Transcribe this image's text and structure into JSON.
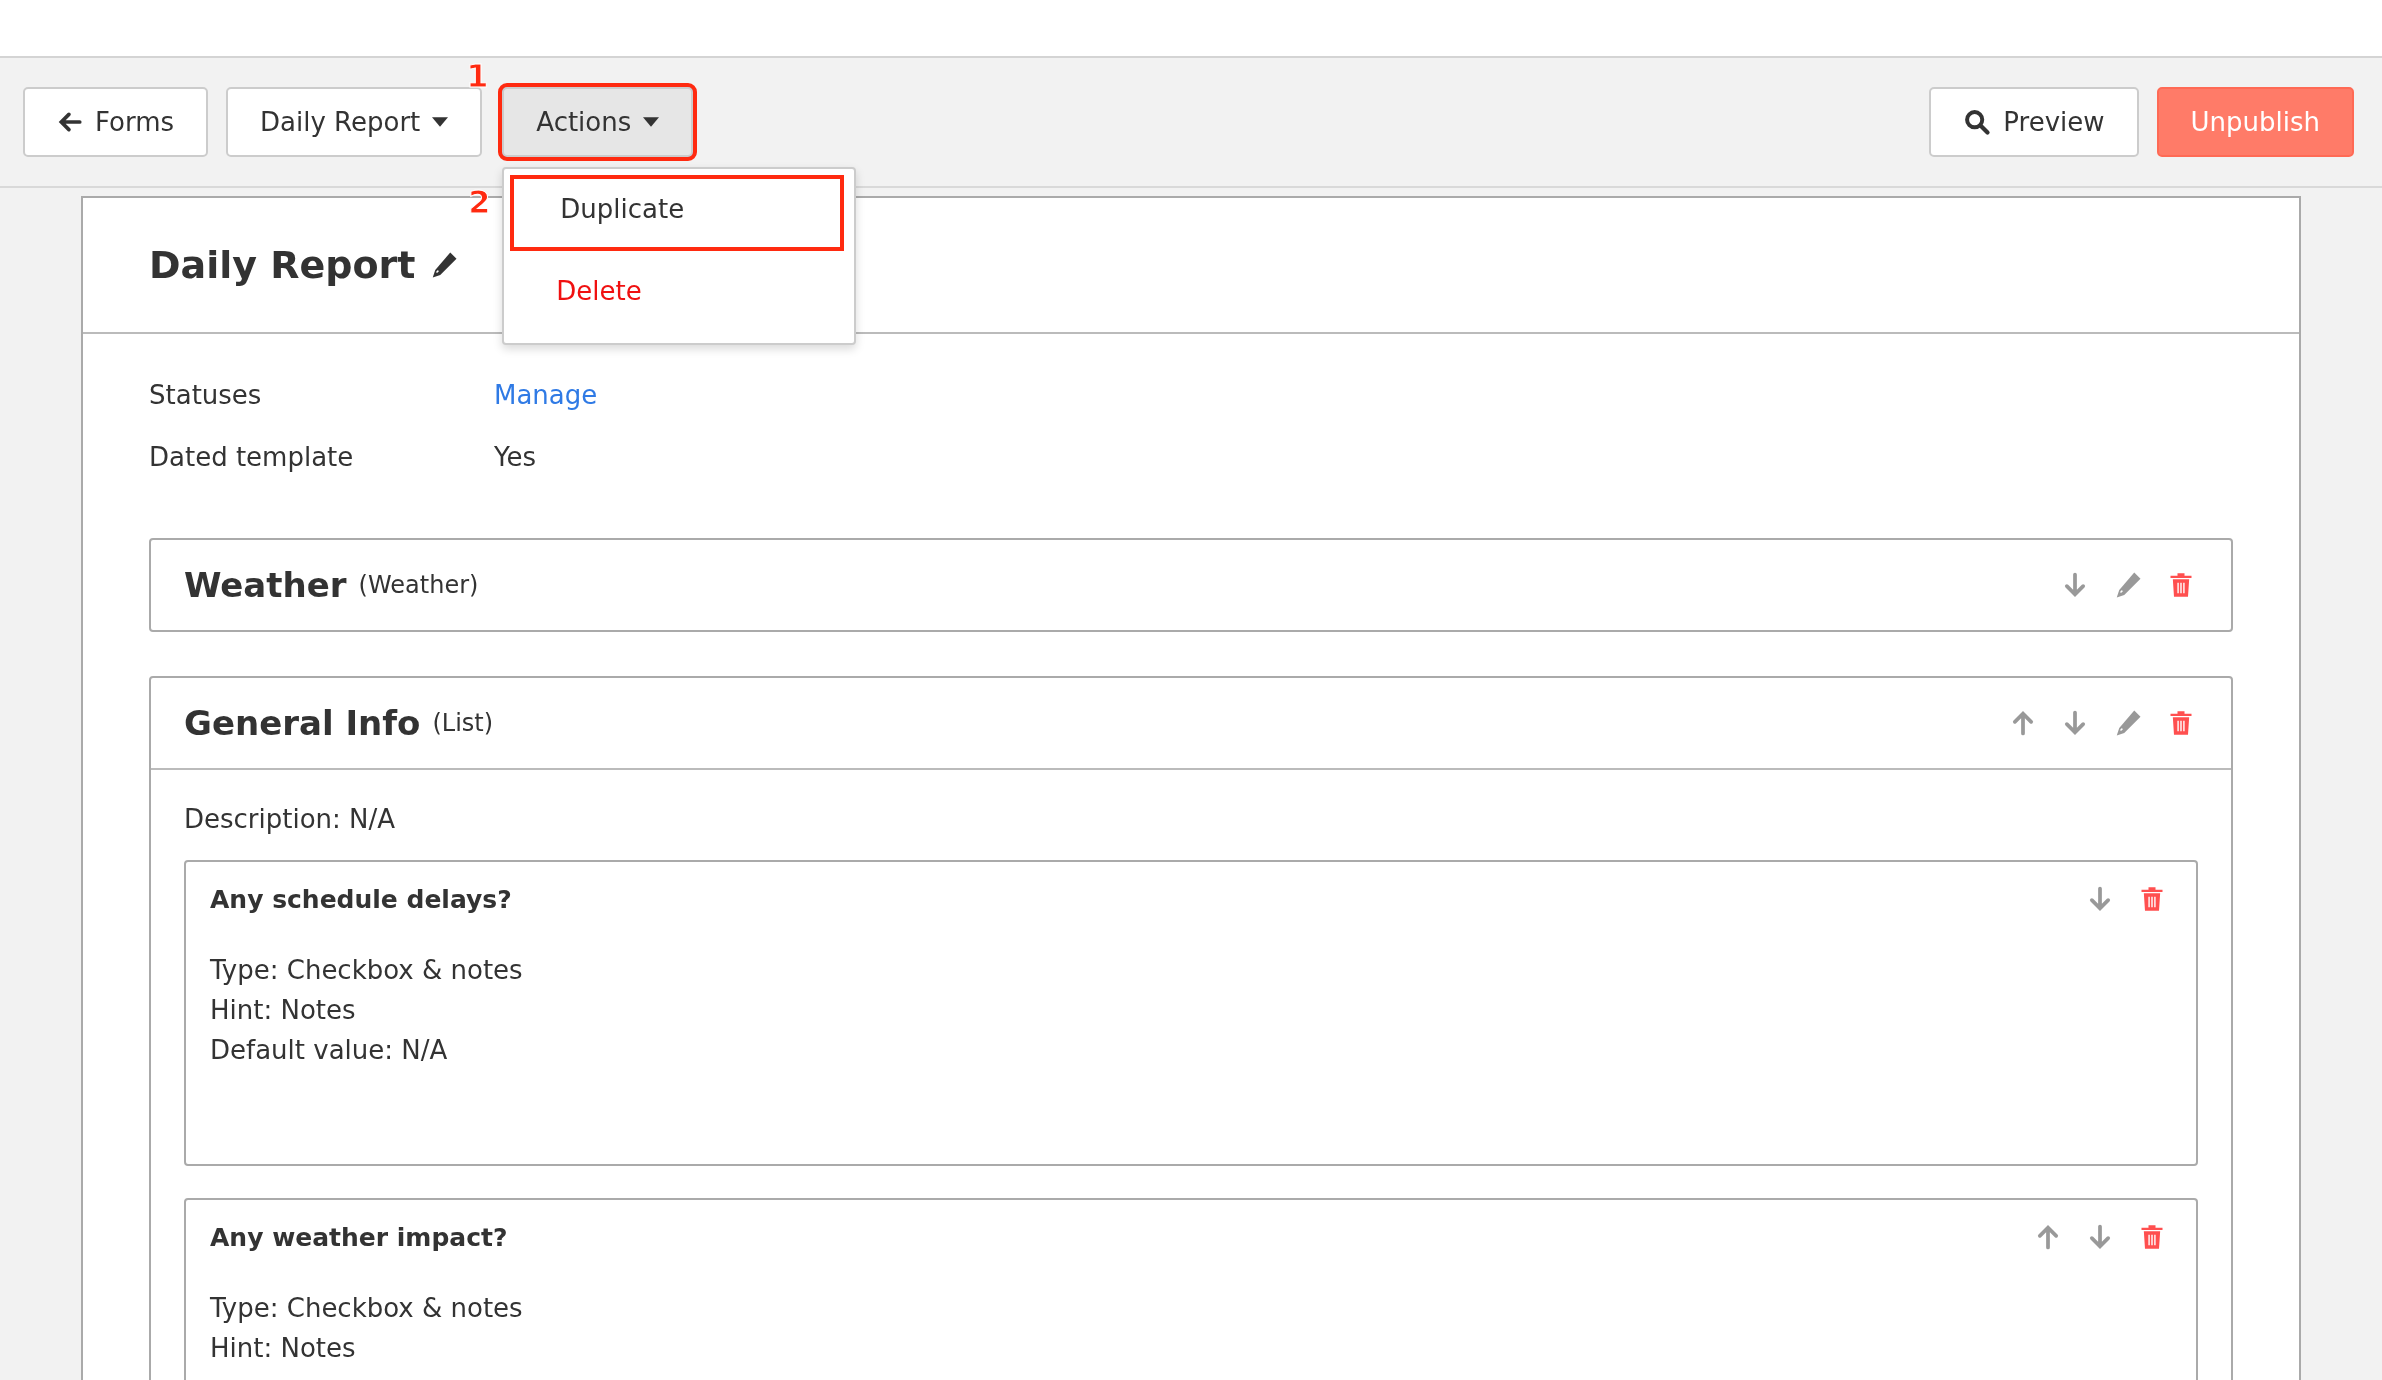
{
  "toolbar": {
    "back_button": "Forms",
    "form_menu": "Daily Report",
    "actions_menu": {
      "label": "Actions",
      "callout": "1",
      "expanded": true,
      "items": [
        {
          "label": "Duplicate",
          "kind": "normal",
          "callout": "2"
        },
        {
          "label": "Delete",
          "kind": "danger"
        }
      ]
    },
    "preview_button": "Preview",
    "unpublish_button": "Unpublish"
  },
  "form": {
    "title": "Daily Report",
    "properties": [
      {
        "label": "Statuses",
        "value": "Manage",
        "kind": "link"
      },
      {
        "label": "Dated template",
        "value": "Yes",
        "kind": "text"
      }
    ],
    "sections": [
      {
        "title": "Weather",
        "type": "(Weather)",
        "can_move_up": false,
        "can_move_down": true
      },
      {
        "title": "General Info",
        "type": "(List)",
        "can_move_up": true,
        "can_move_down": true,
        "description": "Description: N/A",
        "fields": [
          {
            "title": "Any schedule delays?",
            "can_move_up": false,
            "can_move_down": true,
            "details": [
              "Type: Checkbox & notes",
              "Hint: Notes",
              "Default value: N/A"
            ]
          },
          {
            "title": "Any weather impact?",
            "can_move_up": true,
            "can_move_down": true,
            "details": [
              "Type: Checkbox & notes",
              "Hint: Notes"
            ]
          }
        ]
      }
    ]
  }
}
